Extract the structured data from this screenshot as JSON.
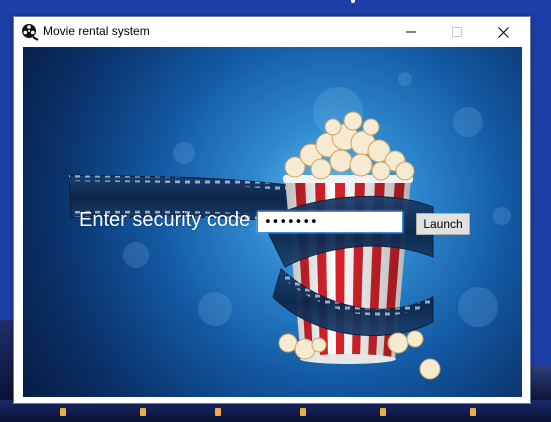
{
  "window": {
    "title": "Movie rental system",
    "controls": {
      "minimize": "minimize",
      "maximize": "maximize",
      "close": "close"
    }
  },
  "form": {
    "prompt": "Enter security code",
    "code_value": "•••••••",
    "launch_label": "Launch"
  },
  "icons": {
    "app": "film-reel-icon",
    "background": "popcorn-and-filmstrip-illustration"
  },
  "colors": {
    "background_blue": "#135aa4",
    "input_focus": "#3a8ee6",
    "popcorn_stripe_red": "#d8232a"
  }
}
